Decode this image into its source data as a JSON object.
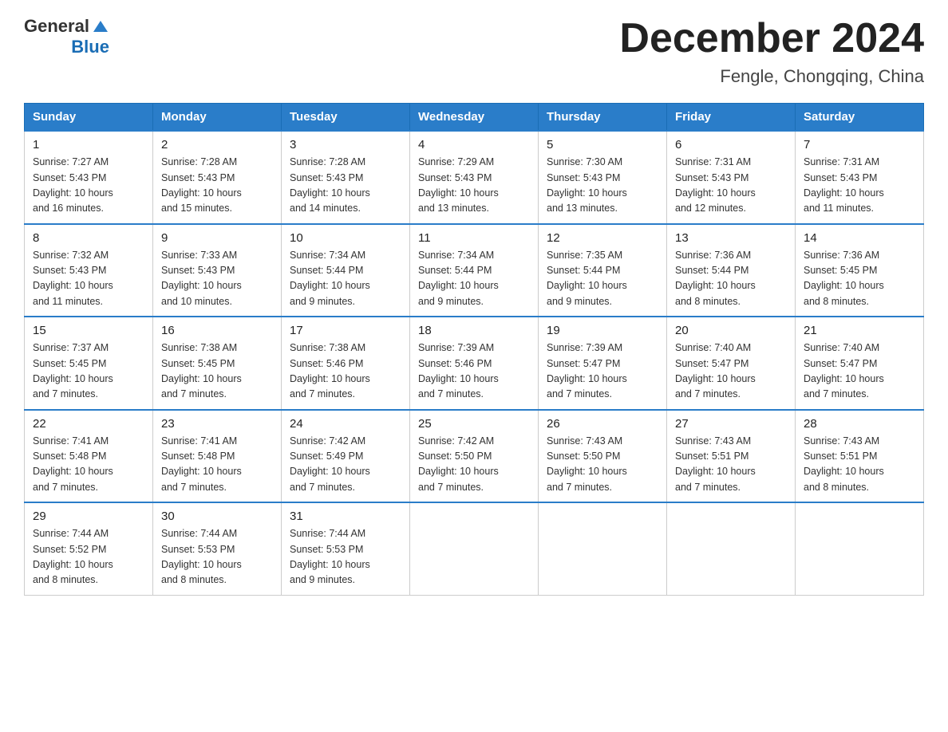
{
  "header": {
    "logo_general": "General",
    "logo_blue": "Blue",
    "month_title": "December 2024",
    "location": "Fengle, Chongqing, China"
  },
  "days_of_week": [
    "Sunday",
    "Monday",
    "Tuesday",
    "Wednesday",
    "Thursday",
    "Friday",
    "Saturday"
  ],
  "weeks": [
    [
      {
        "day": "1",
        "sunrise": "7:27 AM",
        "sunset": "5:43 PM",
        "daylight": "10 hours and 16 minutes."
      },
      {
        "day": "2",
        "sunrise": "7:28 AM",
        "sunset": "5:43 PM",
        "daylight": "10 hours and 15 minutes."
      },
      {
        "day": "3",
        "sunrise": "7:28 AM",
        "sunset": "5:43 PM",
        "daylight": "10 hours and 14 minutes."
      },
      {
        "day": "4",
        "sunrise": "7:29 AM",
        "sunset": "5:43 PM",
        "daylight": "10 hours and 13 minutes."
      },
      {
        "day": "5",
        "sunrise": "7:30 AM",
        "sunset": "5:43 PM",
        "daylight": "10 hours and 13 minutes."
      },
      {
        "day": "6",
        "sunrise": "7:31 AM",
        "sunset": "5:43 PM",
        "daylight": "10 hours and 12 minutes."
      },
      {
        "day": "7",
        "sunrise": "7:31 AM",
        "sunset": "5:43 PM",
        "daylight": "10 hours and 11 minutes."
      }
    ],
    [
      {
        "day": "8",
        "sunrise": "7:32 AM",
        "sunset": "5:43 PM",
        "daylight": "10 hours and 11 minutes."
      },
      {
        "day": "9",
        "sunrise": "7:33 AM",
        "sunset": "5:43 PM",
        "daylight": "10 hours and 10 minutes."
      },
      {
        "day": "10",
        "sunrise": "7:34 AM",
        "sunset": "5:44 PM",
        "daylight": "10 hours and 9 minutes."
      },
      {
        "day": "11",
        "sunrise": "7:34 AM",
        "sunset": "5:44 PM",
        "daylight": "10 hours and 9 minutes."
      },
      {
        "day": "12",
        "sunrise": "7:35 AM",
        "sunset": "5:44 PM",
        "daylight": "10 hours and 9 minutes."
      },
      {
        "day": "13",
        "sunrise": "7:36 AM",
        "sunset": "5:44 PM",
        "daylight": "10 hours and 8 minutes."
      },
      {
        "day": "14",
        "sunrise": "7:36 AM",
        "sunset": "5:45 PM",
        "daylight": "10 hours and 8 minutes."
      }
    ],
    [
      {
        "day": "15",
        "sunrise": "7:37 AM",
        "sunset": "5:45 PM",
        "daylight": "10 hours and 7 minutes."
      },
      {
        "day": "16",
        "sunrise": "7:38 AM",
        "sunset": "5:45 PM",
        "daylight": "10 hours and 7 minutes."
      },
      {
        "day": "17",
        "sunrise": "7:38 AM",
        "sunset": "5:46 PM",
        "daylight": "10 hours and 7 minutes."
      },
      {
        "day": "18",
        "sunrise": "7:39 AM",
        "sunset": "5:46 PM",
        "daylight": "10 hours and 7 minutes."
      },
      {
        "day": "19",
        "sunrise": "7:39 AM",
        "sunset": "5:47 PM",
        "daylight": "10 hours and 7 minutes."
      },
      {
        "day": "20",
        "sunrise": "7:40 AM",
        "sunset": "5:47 PM",
        "daylight": "10 hours and 7 minutes."
      },
      {
        "day": "21",
        "sunrise": "7:40 AM",
        "sunset": "5:47 PM",
        "daylight": "10 hours and 7 minutes."
      }
    ],
    [
      {
        "day": "22",
        "sunrise": "7:41 AM",
        "sunset": "5:48 PM",
        "daylight": "10 hours and 7 minutes."
      },
      {
        "day": "23",
        "sunrise": "7:41 AM",
        "sunset": "5:48 PM",
        "daylight": "10 hours and 7 minutes."
      },
      {
        "day": "24",
        "sunrise": "7:42 AM",
        "sunset": "5:49 PM",
        "daylight": "10 hours and 7 minutes."
      },
      {
        "day": "25",
        "sunrise": "7:42 AM",
        "sunset": "5:50 PM",
        "daylight": "10 hours and 7 minutes."
      },
      {
        "day": "26",
        "sunrise": "7:43 AM",
        "sunset": "5:50 PM",
        "daylight": "10 hours and 7 minutes."
      },
      {
        "day": "27",
        "sunrise": "7:43 AM",
        "sunset": "5:51 PM",
        "daylight": "10 hours and 7 minutes."
      },
      {
        "day": "28",
        "sunrise": "7:43 AM",
        "sunset": "5:51 PM",
        "daylight": "10 hours and 8 minutes."
      }
    ],
    [
      {
        "day": "29",
        "sunrise": "7:44 AM",
        "sunset": "5:52 PM",
        "daylight": "10 hours and 8 minutes."
      },
      {
        "day": "30",
        "sunrise": "7:44 AM",
        "sunset": "5:53 PM",
        "daylight": "10 hours and 8 minutes."
      },
      {
        "day": "31",
        "sunrise": "7:44 AM",
        "sunset": "5:53 PM",
        "daylight": "10 hours and 9 minutes."
      },
      null,
      null,
      null,
      null
    ]
  ],
  "labels": {
    "sunrise": "Sunrise:",
    "sunset": "Sunset:",
    "daylight": "Daylight:"
  }
}
